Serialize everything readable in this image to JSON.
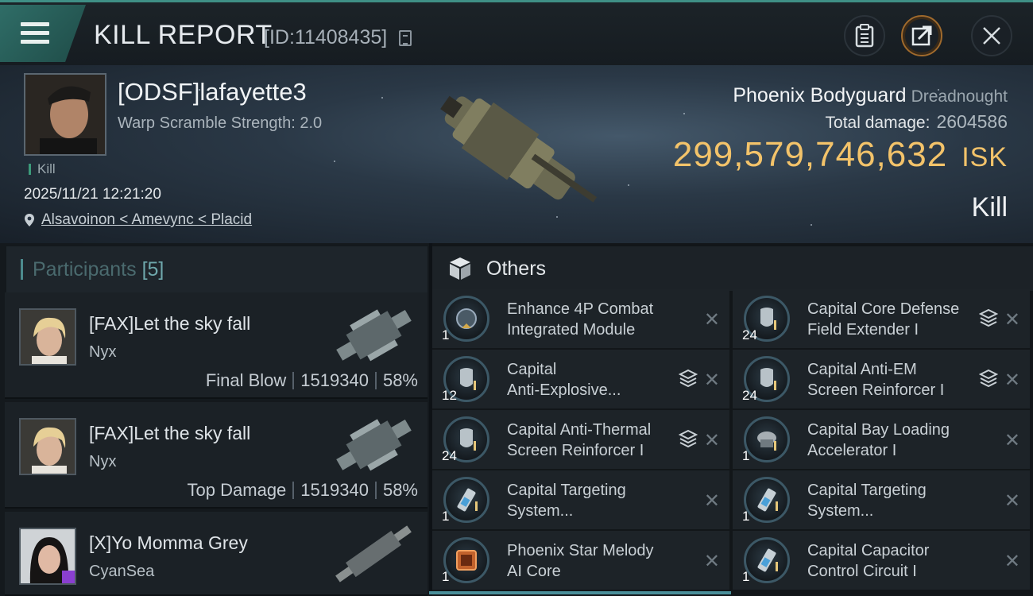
{
  "header": {
    "title": "KILL REPORT",
    "report_id": "[ID:11408435]",
    "icons": [
      "menu-icon",
      "copy-icon",
      "clipboard-icon",
      "share-icon",
      "close-icon"
    ]
  },
  "victim": {
    "name": "[ODSF]lafayette3",
    "warp_scramble": "Warp Scramble Strength: 2.0",
    "tag": "Kill",
    "datetime": "2025/11/21 12:21:20",
    "location": "Alsavoinon < Amevync < Placid",
    "ship": "Phoenix Bodyguard",
    "ship_class": "Dreadnought",
    "total_damage_label": "Total damage:",
    "total_damage": "2604586",
    "isk_value": "299,579,746,632",
    "isk_unit": "ISK",
    "result": "Kill"
  },
  "participants": {
    "label": "Participants",
    "count": "[5]",
    "rows": [
      {
        "name": "[FAX]Let the sky fall",
        "ship": "Nyx",
        "role": "Final Blow",
        "damage": "1519340",
        "percent": "58%"
      },
      {
        "name": "[FAX]Let the sky fall",
        "ship": "Nyx",
        "role": "Top Damage",
        "damage": "1519340",
        "percent": "58%"
      },
      {
        "name": "[X]Yo Momma Grey",
        "ship": "CyanSea",
        "role": "",
        "damage": "",
        "percent": ""
      }
    ]
  },
  "others": {
    "label": "Others",
    "items": [
      {
        "name_l1": "Enhance 4P Combat",
        "name_l2": "Integrated Module",
        "qty": "1",
        "icon": "combat-module-icon",
        "stack": false
      },
      {
        "name_l1": "Capital Core Defense",
        "name_l2": "Field Extender I",
        "qty": "24",
        "icon": "shield-module-icon",
        "stack": true
      },
      {
        "name_l1": "Capital",
        "name_l2": "Anti-Explosive...",
        "qty": "12",
        "icon": "shield-module-icon",
        "stack": true
      },
      {
        "name_l1": "Capital Anti-EM",
        "name_l2": "Screen Reinforcer I",
        "qty": "24",
        "icon": "shield-module-icon",
        "stack": true
      },
      {
        "name_l1": "Capital Anti-Thermal",
        "name_l2": "Screen Reinforcer I",
        "qty": "24",
        "icon": "shield-module-icon",
        "stack": true
      },
      {
        "name_l1": "Capital Bay Loading",
        "name_l2": "Accelerator I",
        "qty": "1",
        "icon": "loader-module-icon",
        "stack": false
      },
      {
        "name_l1": "Capital Targeting",
        "name_l2": "System...",
        "qty": "1",
        "icon": "battery-module-icon",
        "stack": false
      },
      {
        "name_l1": "Capital Targeting",
        "name_l2": "System...",
        "qty": "1",
        "icon": "battery-module-icon",
        "stack": false
      },
      {
        "name_l1": "Phoenix Star Melody",
        "name_l2": "AI Core",
        "qty": "1",
        "icon": "ai-core-icon",
        "stack": false
      },
      {
        "name_l1": "Capital Capacitor",
        "name_l2": "Control Circuit I",
        "qty": "1",
        "icon": "battery-module-icon",
        "stack": false
      }
    ]
  },
  "colors": {
    "accent": "#3f8f86",
    "isk": "#f3c36a",
    "panel": "#1d2328"
  }
}
